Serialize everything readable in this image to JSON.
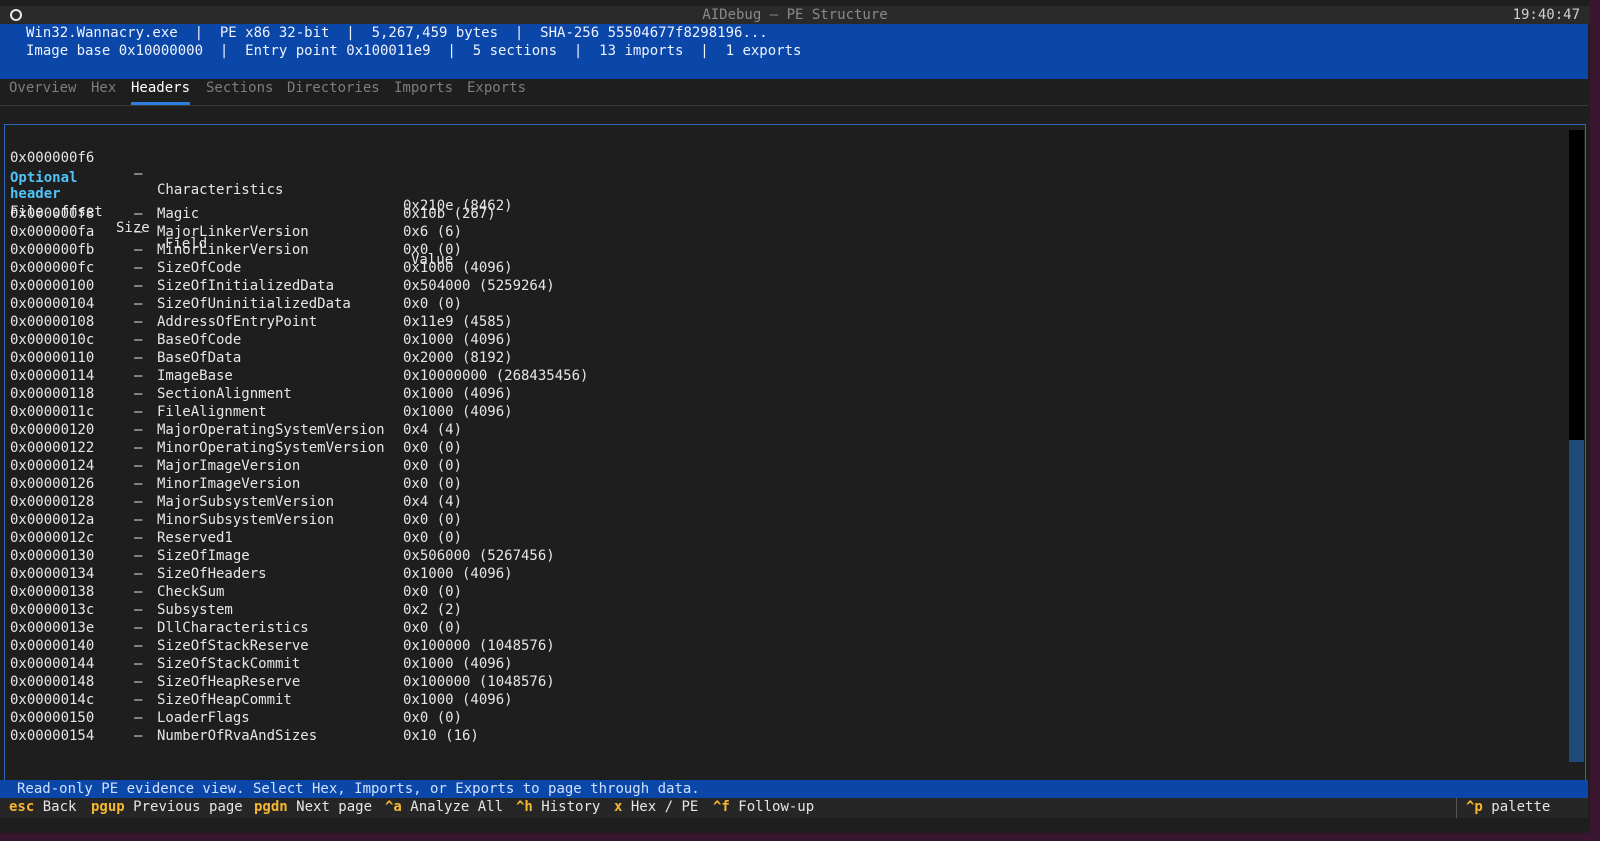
{
  "window": {
    "title": "AIDebug — PE Structure",
    "clock": "19:40:47"
  },
  "info": {
    "line1": "Win32.Wannacry.exe  |  PE x86 32-bit  |  5,267,459 bytes  |  SHA-256 55504677f8298196...",
    "line2": "Image base 0x10000000  |  Entry point 0x100011e9  |  5 sections  |  13 imports  |  1 exports"
  },
  "tabs": [
    "Overview",
    "Hex",
    "Headers",
    "Sections",
    "Directories",
    "Imports",
    "Exports"
  ],
  "active_tab": "Headers",
  "top_row": {
    "offset": "0x000000f6",
    "size": "—",
    "field": "Characteristics",
    "value": "0x210e (8462)"
  },
  "optional_header": {
    "title": "Optional header",
    "columns": {
      "offset": "File offset",
      "size": "Size",
      "field": "Field",
      "value": "Value"
    },
    "rows": [
      {
        "offset": "0x000000f8",
        "size": "—",
        "field": "Magic",
        "value": "0x10b (267)"
      },
      {
        "offset": "0x000000fa",
        "size": "—",
        "field": "MajorLinkerVersion",
        "value": "0x6 (6)"
      },
      {
        "offset": "0x000000fb",
        "size": "—",
        "field": "MinorLinkerVersion",
        "value": "0x0 (0)"
      },
      {
        "offset": "0x000000fc",
        "size": "—",
        "field": "SizeOfCode",
        "value": "0x1000 (4096)"
      },
      {
        "offset": "0x00000100",
        "size": "—",
        "field": "SizeOfInitializedData",
        "value": "0x504000 (5259264)"
      },
      {
        "offset": "0x00000104",
        "size": "—",
        "field": "SizeOfUninitializedData",
        "value": "0x0 (0)"
      },
      {
        "offset": "0x00000108",
        "size": "—",
        "field": "AddressOfEntryPoint",
        "value": "0x11e9 (4585)"
      },
      {
        "offset": "0x0000010c",
        "size": "—",
        "field": "BaseOfCode",
        "value": "0x1000 (4096)"
      },
      {
        "offset": "0x00000110",
        "size": "—",
        "field": "BaseOfData",
        "value": "0x2000 (8192)"
      },
      {
        "offset": "0x00000114",
        "size": "—",
        "field": "ImageBase",
        "value": "0x10000000 (268435456)"
      },
      {
        "offset": "0x00000118",
        "size": "—",
        "field": "SectionAlignment",
        "value": "0x1000 (4096)"
      },
      {
        "offset": "0x0000011c",
        "size": "—",
        "field": "FileAlignment",
        "value": "0x1000 (4096)"
      },
      {
        "offset": "0x00000120",
        "size": "—",
        "field": "MajorOperatingSystemVersion",
        "value": "0x4 (4)"
      },
      {
        "offset": "0x00000122",
        "size": "—",
        "field": "MinorOperatingSystemVersion",
        "value": "0x0 (0)"
      },
      {
        "offset": "0x00000124",
        "size": "—",
        "field": "MajorImageVersion",
        "value": "0x0 (0)"
      },
      {
        "offset": "0x00000126",
        "size": "—",
        "field": "MinorImageVersion",
        "value": "0x0 (0)"
      },
      {
        "offset": "0x00000128",
        "size": "—",
        "field": "MajorSubsystemVersion",
        "value": "0x4 (4)"
      },
      {
        "offset": "0x0000012a",
        "size": "—",
        "field": "MinorSubsystemVersion",
        "value": "0x0 (0)"
      },
      {
        "offset": "0x0000012c",
        "size": "—",
        "field": "Reserved1",
        "value": "0x0 (0)"
      },
      {
        "offset": "0x00000130",
        "size": "—",
        "field": "SizeOfImage",
        "value": "0x506000 (5267456)"
      },
      {
        "offset": "0x00000134",
        "size": "—",
        "field": "SizeOfHeaders",
        "value": "0x1000 (4096)"
      },
      {
        "offset": "0x00000138",
        "size": "—",
        "field": "CheckSum",
        "value": "0x0 (0)"
      },
      {
        "offset": "0x0000013c",
        "size": "—",
        "field": "Subsystem",
        "value": "0x2 (2)"
      },
      {
        "offset": "0x0000013e",
        "size": "—",
        "field": "DllCharacteristics",
        "value": "0x0 (0)"
      },
      {
        "offset": "0x00000140",
        "size": "—",
        "field": "SizeOfStackReserve",
        "value": "0x100000 (1048576)"
      },
      {
        "offset": "0x00000144",
        "size": "—",
        "field": "SizeOfStackCommit",
        "value": "0x1000 (4096)"
      },
      {
        "offset": "0x00000148",
        "size": "—",
        "field": "SizeOfHeapReserve",
        "value": "0x100000 (1048576)"
      },
      {
        "offset": "0x0000014c",
        "size": "—",
        "field": "SizeOfHeapCommit",
        "value": "0x1000 (4096)"
      },
      {
        "offset": "0x00000150",
        "size": "—",
        "field": "LoaderFlags",
        "value": "0x0 (0)"
      },
      {
        "offset": "0x00000154",
        "size": "—",
        "field": "NumberOfRvaAndSizes",
        "value": "0x10 (16)"
      }
    ]
  },
  "status": "Read-only PE evidence view. Select Hex, Imports, or Exports to page through data.",
  "footer": {
    "keys": [
      {
        "key": "esc",
        "label": "Back"
      },
      {
        "key": "pgup",
        "label": "Previous page"
      },
      {
        "key": "pgdn",
        "label": "Next page"
      },
      {
        "key": "^a",
        "label": "Analyze All"
      },
      {
        "key": "^h",
        "label": "History"
      },
      {
        "key": "x",
        "label": "Hex / PE"
      },
      {
        "key": "^f",
        "label": "Follow-up"
      }
    ],
    "palette": {
      "key": "^p",
      "label": "palette"
    }
  }
}
